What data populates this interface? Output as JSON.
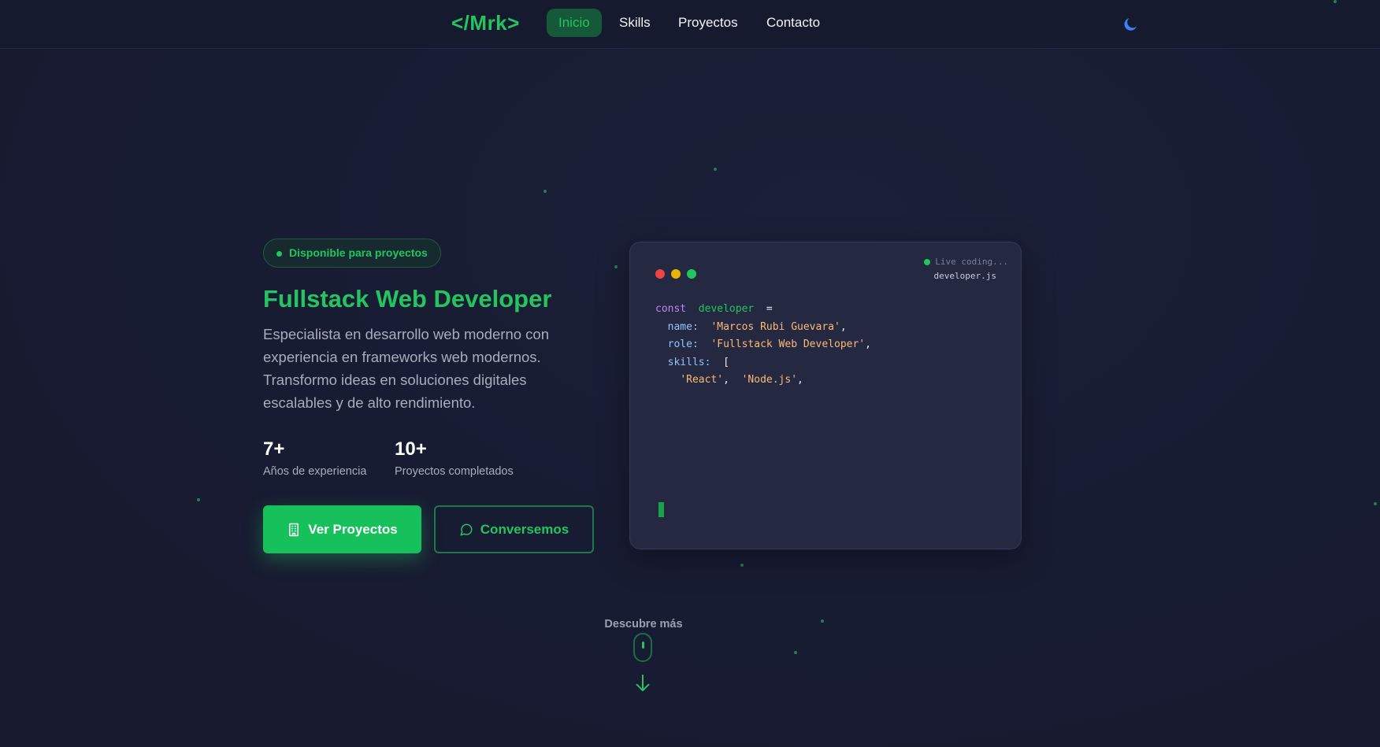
{
  "nav": {
    "logo": "</Mrk>",
    "links": [
      {
        "label": "Inicio",
        "active": true
      },
      {
        "label": "Skills",
        "active": false
      },
      {
        "label": "Proyectos",
        "active": false
      },
      {
        "label": "Contacto",
        "active": false
      }
    ],
    "theme_toggle_icon": "moon-icon"
  },
  "hero": {
    "badge": "Disponible para proyectos",
    "title": "Fullstack Web Developer",
    "description": "Especialista en desarrollo web moderno con experiencia en frameworks web modernos. Transformo ideas en soluciones digitales escalables y de alto rendimiento.",
    "stats": [
      {
        "value": "7+",
        "label": "Años de experiencia"
      },
      {
        "value": "10+",
        "label": "Proyectos completados"
      }
    ],
    "primary_button": "Ver Proyectos",
    "secondary_button": "Conversemos"
  },
  "code_card": {
    "status": "Live coding...",
    "filename": "developer.js",
    "line1": {
      "kw": "const",
      "var": "developer",
      "op": "="
    },
    "line2": {
      "prop": "name:",
      "str": "'Marcos Rubi Guevara'",
      "punc": ","
    },
    "line3": {
      "prop": "role:",
      "str": "'Fullstack Web Developer'",
      "punc": ","
    },
    "line4": {
      "prop": "skills:",
      "punc": "["
    },
    "line5": {
      "str1": "'React'",
      "sep": ",",
      "str2": "'Node.js'",
      "punc": ","
    }
  },
  "scroll": {
    "label": "Descubre más"
  },
  "colors": {
    "accent": "#22c55e",
    "background": "#181c33",
    "card": "#242840"
  }
}
